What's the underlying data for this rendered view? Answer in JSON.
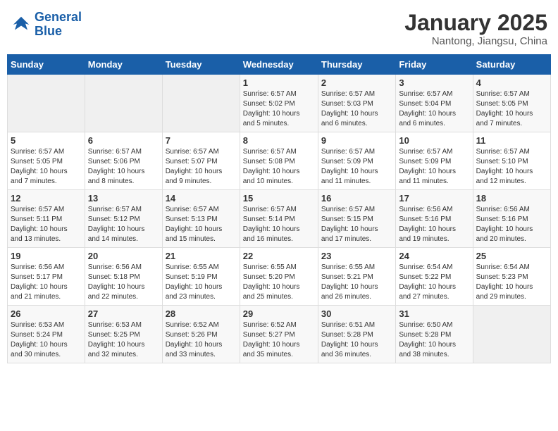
{
  "header": {
    "logo_line1": "General",
    "logo_line2": "Blue",
    "month_title": "January 2025",
    "location": "Nantong, Jiangsu, China"
  },
  "days_of_week": [
    "Sunday",
    "Monday",
    "Tuesday",
    "Wednesday",
    "Thursday",
    "Friday",
    "Saturday"
  ],
  "weeks": [
    [
      {
        "day": "",
        "info": ""
      },
      {
        "day": "",
        "info": ""
      },
      {
        "day": "",
        "info": ""
      },
      {
        "day": "1",
        "info": "Sunrise: 6:57 AM\nSunset: 5:02 PM\nDaylight: 10 hours\nand 5 minutes."
      },
      {
        "day": "2",
        "info": "Sunrise: 6:57 AM\nSunset: 5:03 PM\nDaylight: 10 hours\nand 6 minutes."
      },
      {
        "day": "3",
        "info": "Sunrise: 6:57 AM\nSunset: 5:04 PM\nDaylight: 10 hours\nand 6 minutes."
      },
      {
        "day": "4",
        "info": "Sunrise: 6:57 AM\nSunset: 5:05 PM\nDaylight: 10 hours\nand 7 minutes."
      }
    ],
    [
      {
        "day": "5",
        "info": "Sunrise: 6:57 AM\nSunset: 5:05 PM\nDaylight: 10 hours\nand 7 minutes."
      },
      {
        "day": "6",
        "info": "Sunrise: 6:57 AM\nSunset: 5:06 PM\nDaylight: 10 hours\nand 8 minutes."
      },
      {
        "day": "7",
        "info": "Sunrise: 6:57 AM\nSunset: 5:07 PM\nDaylight: 10 hours\nand 9 minutes."
      },
      {
        "day": "8",
        "info": "Sunrise: 6:57 AM\nSunset: 5:08 PM\nDaylight: 10 hours\nand 10 minutes."
      },
      {
        "day": "9",
        "info": "Sunrise: 6:57 AM\nSunset: 5:09 PM\nDaylight: 10 hours\nand 11 minutes."
      },
      {
        "day": "10",
        "info": "Sunrise: 6:57 AM\nSunset: 5:09 PM\nDaylight: 10 hours\nand 11 minutes."
      },
      {
        "day": "11",
        "info": "Sunrise: 6:57 AM\nSunset: 5:10 PM\nDaylight: 10 hours\nand 12 minutes."
      }
    ],
    [
      {
        "day": "12",
        "info": "Sunrise: 6:57 AM\nSunset: 5:11 PM\nDaylight: 10 hours\nand 13 minutes."
      },
      {
        "day": "13",
        "info": "Sunrise: 6:57 AM\nSunset: 5:12 PM\nDaylight: 10 hours\nand 14 minutes."
      },
      {
        "day": "14",
        "info": "Sunrise: 6:57 AM\nSunset: 5:13 PM\nDaylight: 10 hours\nand 15 minutes."
      },
      {
        "day": "15",
        "info": "Sunrise: 6:57 AM\nSunset: 5:14 PM\nDaylight: 10 hours\nand 16 minutes."
      },
      {
        "day": "16",
        "info": "Sunrise: 6:57 AM\nSunset: 5:15 PM\nDaylight: 10 hours\nand 17 minutes."
      },
      {
        "day": "17",
        "info": "Sunrise: 6:56 AM\nSunset: 5:16 PM\nDaylight: 10 hours\nand 19 minutes."
      },
      {
        "day": "18",
        "info": "Sunrise: 6:56 AM\nSunset: 5:16 PM\nDaylight: 10 hours\nand 20 minutes."
      }
    ],
    [
      {
        "day": "19",
        "info": "Sunrise: 6:56 AM\nSunset: 5:17 PM\nDaylight: 10 hours\nand 21 minutes."
      },
      {
        "day": "20",
        "info": "Sunrise: 6:56 AM\nSunset: 5:18 PM\nDaylight: 10 hours\nand 22 minutes."
      },
      {
        "day": "21",
        "info": "Sunrise: 6:55 AM\nSunset: 5:19 PM\nDaylight: 10 hours\nand 23 minutes."
      },
      {
        "day": "22",
        "info": "Sunrise: 6:55 AM\nSunset: 5:20 PM\nDaylight: 10 hours\nand 25 minutes."
      },
      {
        "day": "23",
        "info": "Sunrise: 6:55 AM\nSunset: 5:21 PM\nDaylight: 10 hours\nand 26 minutes."
      },
      {
        "day": "24",
        "info": "Sunrise: 6:54 AM\nSunset: 5:22 PM\nDaylight: 10 hours\nand 27 minutes."
      },
      {
        "day": "25",
        "info": "Sunrise: 6:54 AM\nSunset: 5:23 PM\nDaylight: 10 hours\nand 29 minutes."
      }
    ],
    [
      {
        "day": "26",
        "info": "Sunrise: 6:53 AM\nSunset: 5:24 PM\nDaylight: 10 hours\nand 30 minutes."
      },
      {
        "day": "27",
        "info": "Sunrise: 6:53 AM\nSunset: 5:25 PM\nDaylight: 10 hours\nand 32 minutes."
      },
      {
        "day": "28",
        "info": "Sunrise: 6:52 AM\nSunset: 5:26 PM\nDaylight: 10 hours\nand 33 minutes."
      },
      {
        "day": "29",
        "info": "Sunrise: 6:52 AM\nSunset: 5:27 PM\nDaylight: 10 hours\nand 35 minutes."
      },
      {
        "day": "30",
        "info": "Sunrise: 6:51 AM\nSunset: 5:28 PM\nDaylight: 10 hours\nand 36 minutes."
      },
      {
        "day": "31",
        "info": "Sunrise: 6:50 AM\nSunset: 5:28 PM\nDaylight: 10 hours\nand 38 minutes."
      },
      {
        "day": "",
        "info": ""
      }
    ]
  ]
}
